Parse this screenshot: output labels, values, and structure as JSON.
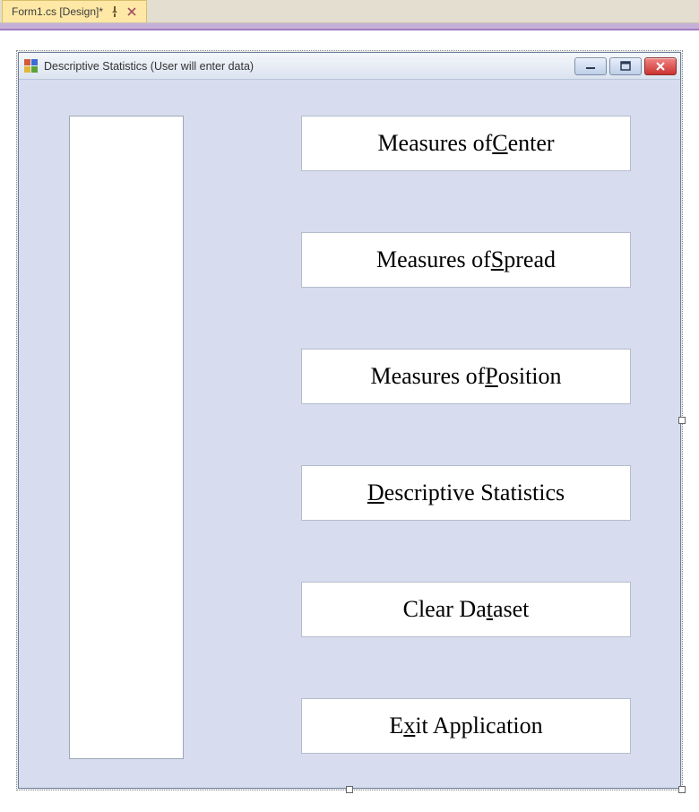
{
  "ide": {
    "tab": {
      "label": "Form1.cs [Design]*"
    }
  },
  "form": {
    "title": "Descriptive Statistics (User will enter data)"
  },
  "buttons": {
    "center": {
      "pre": "Measures of ",
      "accel": "C",
      "post": "enter"
    },
    "spread": {
      "pre": "Measures of ",
      "accel": "S",
      "post": "pread"
    },
    "position": {
      "pre": "Measures of ",
      "accel": "P",
      "post": "osition"
    },
    "descriptive": {
      "pre": "",
      "accel": "D",
      "post": "escriptive Statistics"
    },
    "clear": {
      "pre": "Clear Da",
      "accel": "t",
      "post": "aset"
    },
    "exit": {
      "pre": "E",
      "accel": "x",
      "post": "it Application"
    }
  }
}
